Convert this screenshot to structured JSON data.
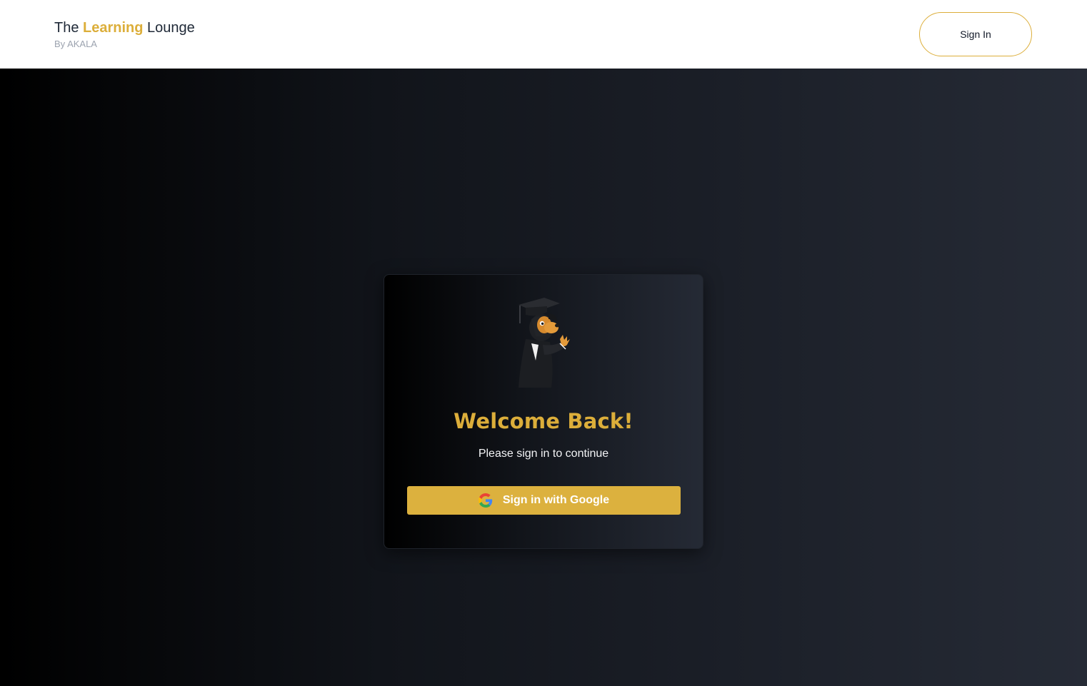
{
  "header": {
    "brand_prefix": "The",
    "brand_accent": "Learning",
    "brand_suffix": "Lounge",
    "brand_byline": "By AKALA",
    "signin_label": "Sign In"
  },
  "card": {
    "mascot_icon": "graduate-mascot-icon",
    "title": "Welcome Back!",
    "subtitle": "Please sign in to continue",
    "google_button_label": "Sign in with Google",
    "google_icon": "google-g-icon"
  },
  "colors": {
    "accent": "#dcae3a",
    "button": "#dcb13e",
    "header_bg": "#ffffff",
    "main_bg_start": "#000000",
    "main_bg_end": "#262b36"
  }
}
